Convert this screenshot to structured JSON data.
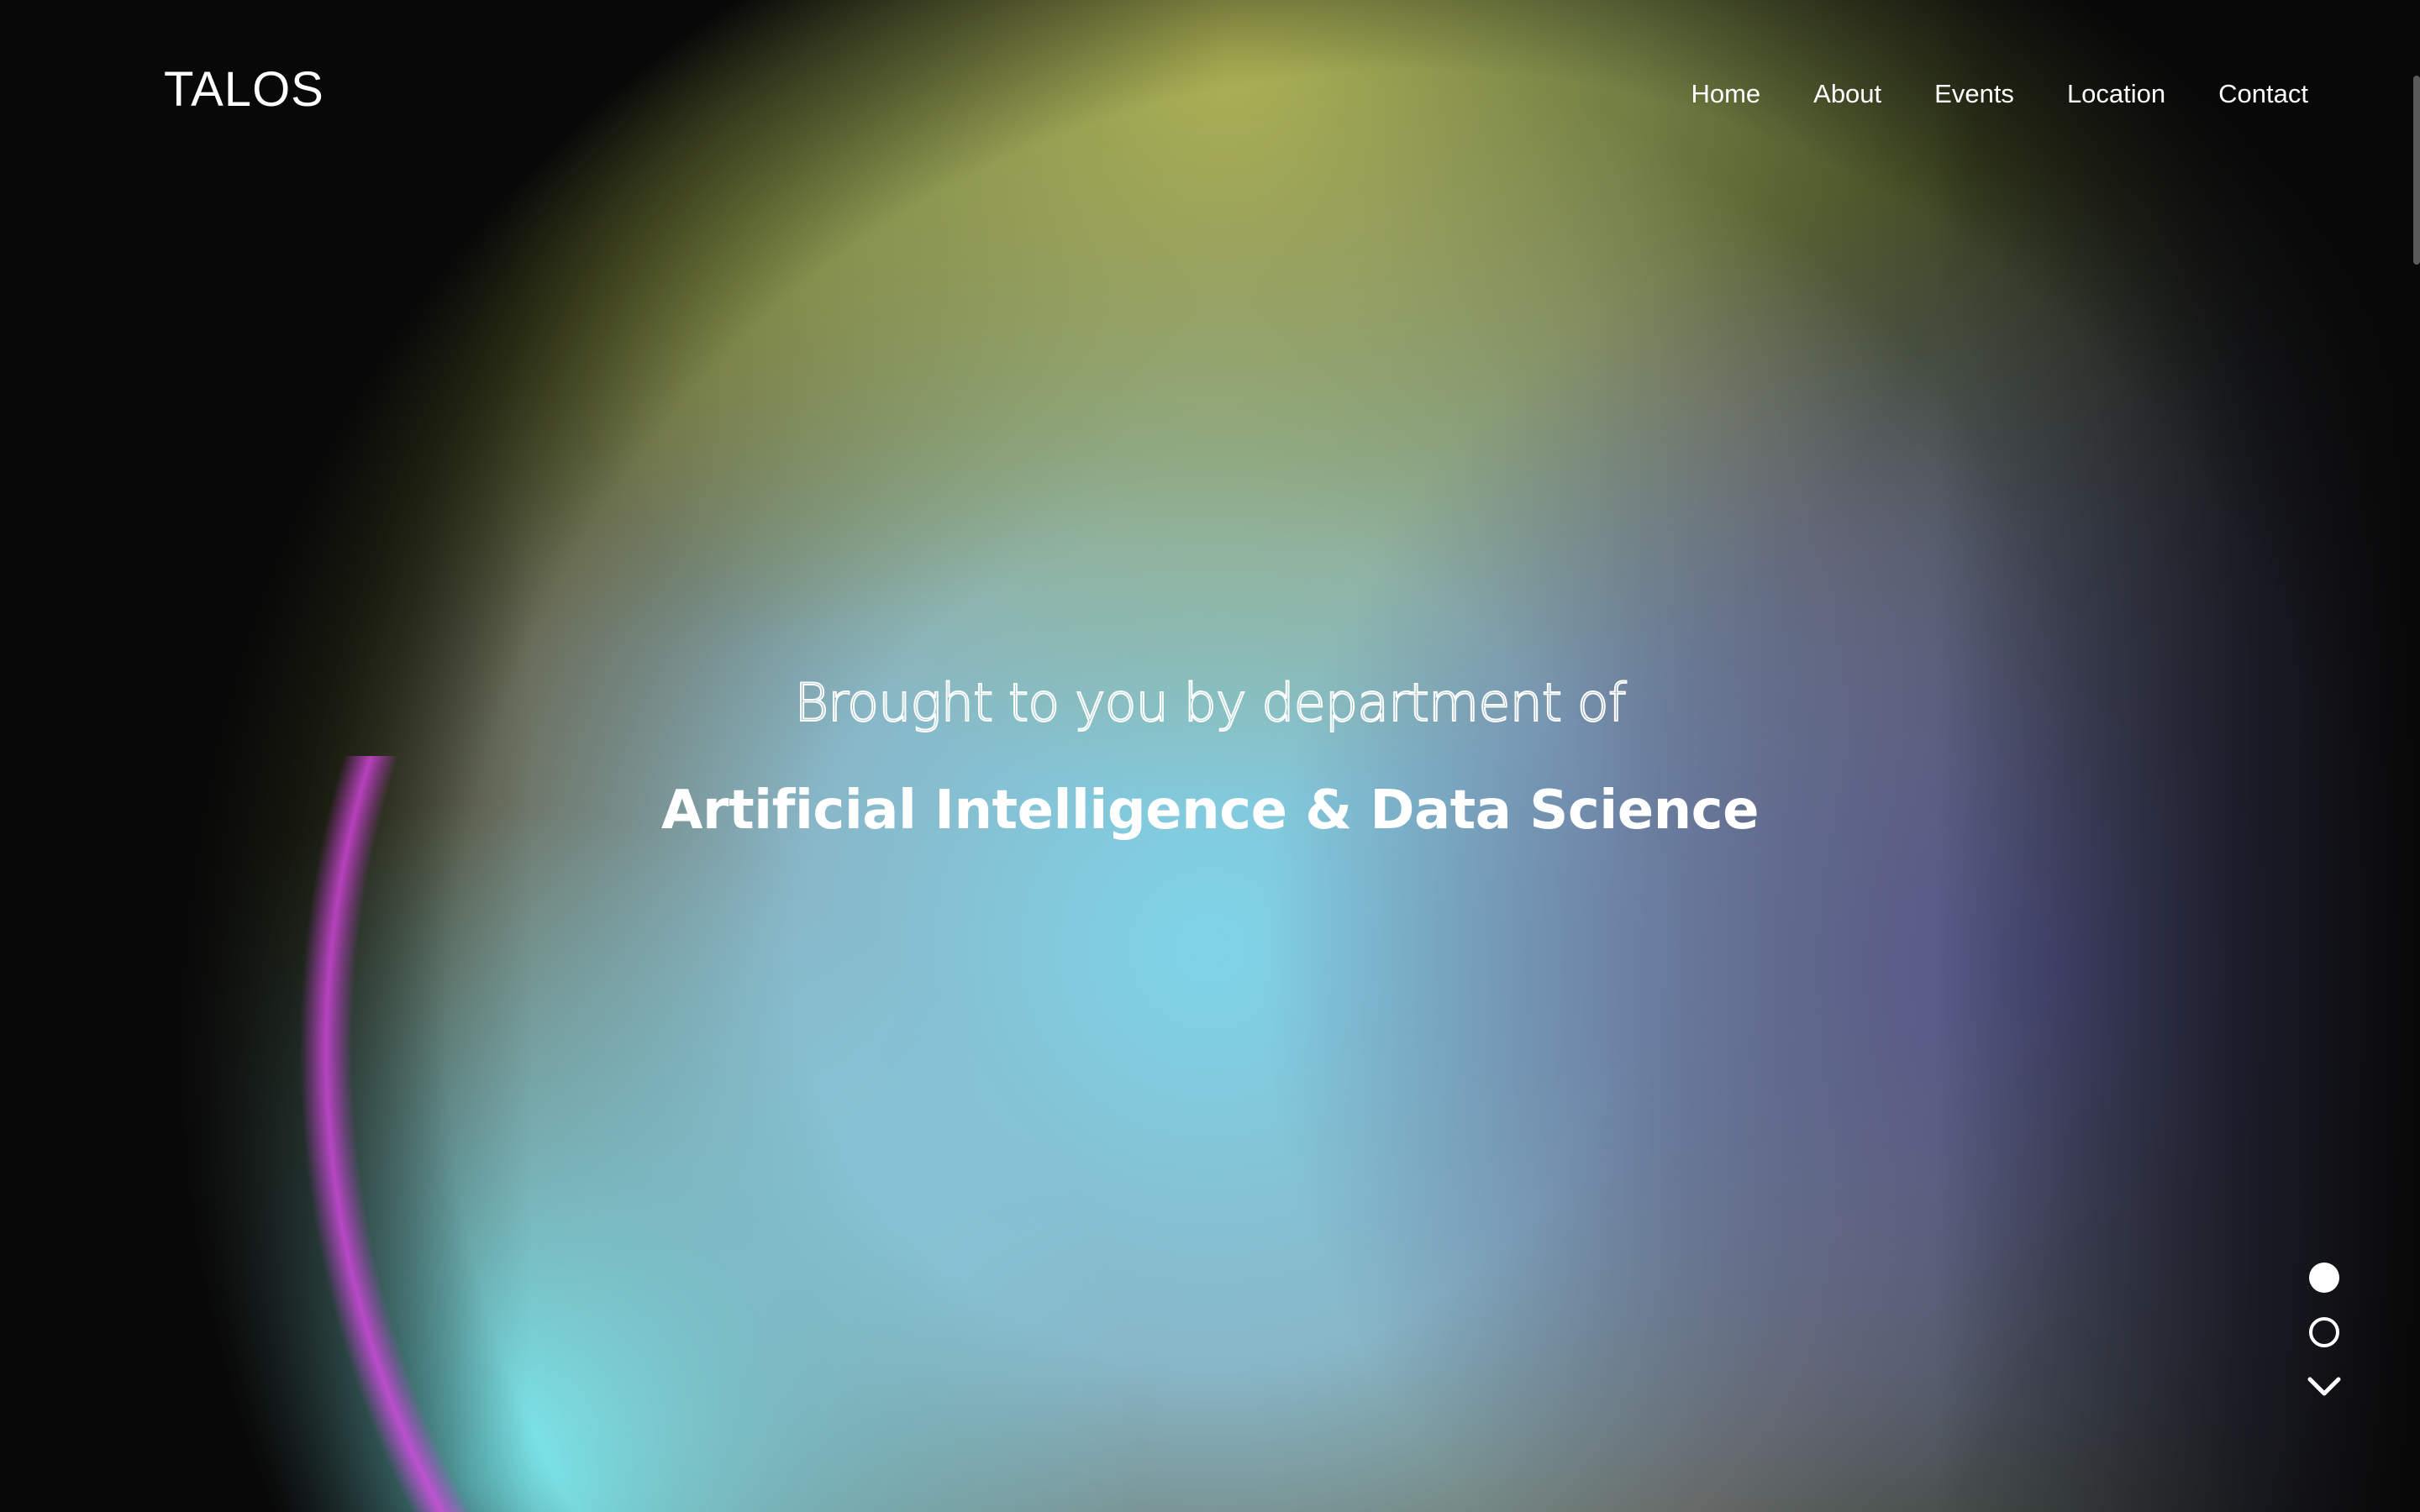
{
  "header": {
    "logo": "TALOS",
    "nav": [
      {
        "label": "Home"
      },
      {
        "label": "About"
      },
      {
        "label": "Events"
      },
      {
        "label": "Location"
      },
      {
        "label": "Contact"
      }
    ]
  },
  "hero": {
    "subtitle": "Brought to you by department of",
    "title": "Artificial Intelligence & Data Science"
  },
  "pager": {
    "slides_total": 2,
    "active_slide": 1,
    "next_icon": "chevron-down-icon"
  },
  "colors": {
    "background": "#080808",
    "text": "#ffffff",
    "gradient_yellow": "#a8b050",
    "gradient_cyan": "#7ef5fa",
    "gradient_purple": "#4a4a7e",
    "gradient_magenta": "#e040f0"
  }
}
